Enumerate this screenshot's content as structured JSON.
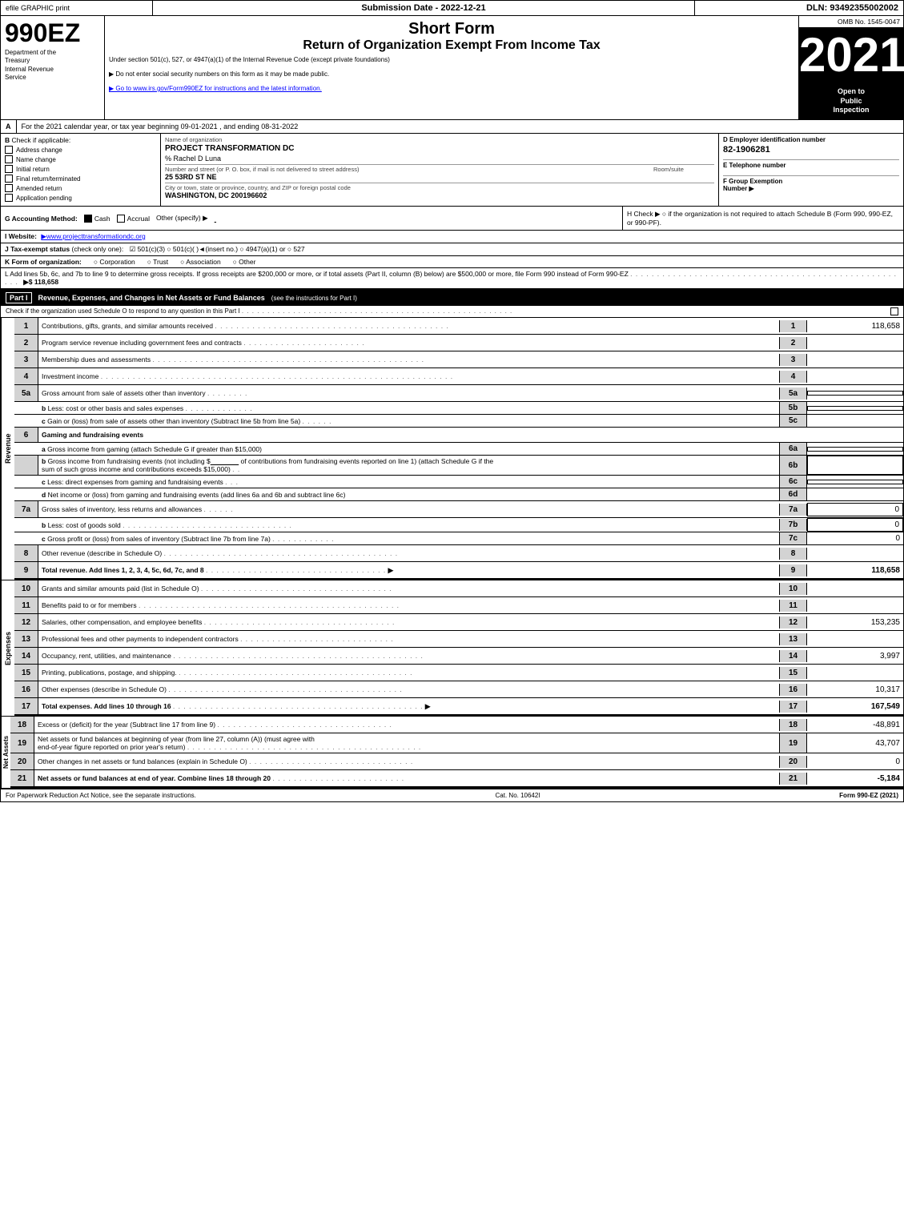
{
  "header": {
    "efile": "efile GRAPHIC print",
    "submission": "Submission Date - 2022-12-21",
    "dln": "DLN: 93492355002002",
    "omb": "OMB No. 1545-0047"
  },
  "form": {
    "number": "990EZ",
    "dept1": "Department of the",
    "dept2": "Treasury",
    "dept3": "Internal Revenue",
    "dept4": "Service",
    "short_form": "Short Form",
    "return_title": "Return of Organization Exempt From Income Tax",
    "under_section": "Under section 501(c), 527, or 4947(a)(1) of the Internal Revenue Code (except private foundations)",
    "do_not_enter": "▶ Do not enter social security numbers on this form as it may be made public.",
    "go_to": "▶ Go to www.irs.gov/Form990EZ for instructions and the latest information.",
    "year": "2021",
    "open_to_public": "Open to\nPublic\nInspection"
  },
  "section_a": {
    "label": "A",
    "text": "For the 2021 calendar year, or tax year beginning 09-01-2021 , and ending 08-31-2022"
  },
  "section_b": {
    "label": "B",
    "sublabel": "Check if applicable:",
    "items": [
      {
        "label": "Address change",
        "checked": false
      },
      {
        "label": "Name change",
        "checked": false
      },
      {
        "label": "Initial return",
        "checked": false
      },
      {
        "label": "Final return/terminated",
        "checked": false
      },
      {
        "label": "Amended return",
        "checked": false
      },
      {
        "label": "Application pending",
        "checked": false
      }
    ]
  },
  "section_c": {
    "label": "C",
    "name_label": "Name of organization",
    "org_name": "PROJECT TRANSFORMATION DC",
    "care_of": "% Rachel D Luna",
    "street_label": "Number and street (or P. O. box, if mail is not delivered to street address)",
    "street": "25 53RD ST NE",
    "room_label": "Room/suite",
    "city_label": "City or town, state or province, country, and ZIP or foreign postal code",
    "city": "WASHINGTON, DC  200196602"
  },
  "section_d": {
    "label": "D",
    "ein_label": "D Employer identification number",
    "ein": "82-1906281",
    "phone_label": "E Telephone number"
  },
  "section_f": {
    "label": "F",
    "group_label": "F Group Exemption\nNumber"
  },
  "section_g": {
    "label": "G",
    "accounting_label": "G Accounting Method:",
    "cash": "Cash",
    "accrual": "Accrual",
    "other": "Other (specify) ▶",
    "cash_checked": true
  },
  "section_h": {
    "label": "H",
    "text": "H  Check ▶  ○ if the organization is not required to attach Schedule B (Form 990, 990-EZ, or 990-PF)."
  },
  "website": {
    "label": "I Website:",
    "url": "▶www.projecttransformationdc.org"
  },
  "tax_exempt": {
    "label": "J Tax-exempt status",
    "note": "(check only one):",
    "options": "☑ 501(c)(3)  ○ 501(c)(  )◄(insert no.)  ○ 4947(a)(1) or  ○ 527"
  },
  "form_k": {
    "label": "K",
    "text": "K Form of organization:",
    "options": [
      "○ Corporation",
      "○ Trust",
      "○ Association",
      "○ Other"
    ]
  },
  "form_l": {
    "label": "L",
    "text": "L Add lines 5b, 6c, and 7b to line 9 to determine gross receipts. If gross receipts are $200,000 or more, or if total assets (Part II, column (B) below) are $500,000 or more, file Form 990 instead of Form 990-EZ",
    "dots": ". . . . . . . . . . . . . . . . . . . . . . . . . . . . . . . . . . . . . . . . . .",
    "arrow": "▶$",
    "value": "118,658"
  },
  "part1": {
    "label": "Part I",
    "title": "Revenue, Expenses, and Changes in Net Assets or Fund Balances",
    "see_instructions": "(see the instructions for Part I)",
    "check_note": "Check if the organization used Schedule O to respond to any question in this Part I",
    "dots_long": ". . . . . . . . . . . . . . . . . . . . . . . . . . . . . . . . . . . . . . . . . . . . . . . .",
    "rows": [
      {
        "num": "1",
        "label": "Contributions, gifts, grants, and similar amounts received",
        "dots": ". . . . . . . . . . . . . . . . . . . . . . . . . . . . . . . . . . . . . . . . . . . .",
        "ref": "1",
        "value": "118,658"
      },
      {
        "num": "2",
        "label": "Program service revenue including government fees and contracts",
        "dots": ". . . . . . . . . . . . . . . . . . . . . . .",
        "ref": "2",
        "value": ""
      },
      {
        "num": "3",
        "label": "Membership dues and assessments",
        "dots": ". . . . . . . . . . . . . . . . . . . . . . . . . . . . . . . . . . . . . . . . . . . . . . . . . . .",
        "ref": "3",
        "value": ""
      },
      {
        "num": "4",
        "label": "Investment income",
        "dots": ". . . . . . . . . . . . . . . . . . . . . . . . . . . . . . . . . . . . . . . . . . . . . . . . . . . . . . . . . . . . . . . . . .",
        "ref": "4",
        "value": ""
      },
      {
        "num": "5a",
        "label": "Gross amount from sale of assets other than inventory",
        "dots": ". . . . . . . .",
        "ref": "5a",
        "value": ""
      },
      {
        "num": "5b",
        "label": "Less: cost or other basis and sales expenses",
        "dots": ". . . . . . . . . . . .",
        "ref": "5b",
        "value": ""
      },
      {
        "num": "5c",
        "label": "Gain or (loss) from sale of assets other than inventory (Subtract line 5b from line 5a)",
        "dots": ". . . . . .",
        "ref": "5c",
        "value": ""
      },
      {
        "num": "6",
        "label": "Gaming and fundraising events",
        "dots": "",
        "ref": "",
        "value": ""
      },
      {
        "num": "6a",
        "label": "Gross income from gaming (attach Schedule G if greater than $15,000)",
        "dots": "",
        "ref": "6a",
        "value": ""
      },
      {
        "num": "6b",
        "label": "Gross income from fundraising events (not including $_____ of contributions from fundraising events reported on line 1) (attach Schedule G if the sum of such gross income and contributions exceeds $15,000)",
        "dots": ". .",
        "ref": "6b",
        "value": ""
      },
      {
        "num": "6c",
        "label": "Less: direct expenses from gaming and fundraising events",
        "dots": ". . .",
        "ref": "6c",
        "value": ""
      },
      {
        "num": "6d",
        "label": "Net income or (loss) from gaming and fundraising events (add lines 6a and 6b and subtract line 6c)",
        "dots": "",
        "ref": "6d",
        "value": ""
      },
      {
        "num": "7a",
        "label": "Gross sales of inventory, less returns and allowances",
        "dots": ". . . . . .",
        "ref": "7a",
        "value": "0"
      },
      {
        "num": "7b",
        "label": "Less: cost of goods sold",
        "dots": ". . . . . . . . . . . . . . . . . . . . . . . . . . . . . . . .",
        "ref": "7b",
        "value": "0"
      },
      {
        "num": "7c",
        "label": "Gross profit or (loss) from sales of inventory (Subtract line 7b from line 7a)",
        "dots": ". . . . . . . . . . . .",
        "ref": "7c",
        "value": "0"
      },
      {
        "num": "8",
        "label": "Other revenue (describe in Schedule O)",
        "dots": ". . . . . . . . . . . . . . . . . . . . . . . . . . . . . . . . . . . . . . . . . . . .",
        "ref": "8",
        "value": ""
      },
      {
        "num": "9",
        "label": "Total revenue. Add lines 1, 2, 3, 4, 5c, 6d, 7c, and 8",
        "dots": ". . . . . . . . . . . . . . . . . . . . . . . . . . . . . . . . . .",
        "arrow": "▶",
        "ref": "9",
        "value": "118,658",
        "bold": true
      }
    ]
  },
  "expenses": {
    "rows": [
      {
        "num": "10",
        "label": "Grants and similar amounts paid (list in Schedule O)",
        "dots": ". . . . . . . . . . . . . . . . . . . . . . . . . . . . . . . . . . . .",
        "ref": "10",
        "value": ""
      },
      {
        "num": "11",
        "label": "Benefits paid to or for members",
        "dots": ". . . . . . . . . . . . . . . . . . . . . . . . . . . . . . . . . . . . . . . . . . . . . . . . .",
        "ref": "11",
        "value": ""
      },
      {
        "num": "12",
        "label": "Salaries, other compensation, and employee benefits",
        "dots": ". . . . . . . . . . . . . . . . . . . . . . . . . . . . . . . . . . . .",
        "ref": "12",
        "value": "153,235"
      },
      {
        "num": "13",
        "label": "Professional fees and other payments to independent contractors",
        "dots": ". . . . . . . . . . . . . . . . . . . . . . . . . . . . .",
        "ref": "13",
        "value": ""
      },
      {
        "num": "14",
        "label": "Occupancy, rent, utilities, and maintenance",
        "dots": ". . . . . . . . . . . . . . . . . . . . . . . . . . . . . . . . . . . . . . . . . . . . . . . .",
        "ref": "14",
        "value": "3,997"
      },
      {
        "num": "15",
        "label": "Printing, publications, postage, and shipping.",
        "dots": ". . . . . . . . . . . . . . . . . . . . . . . . . . . . . . . . . . . . . . . . . . . . .",
        "ref": "15",
        "value": ""
      },
      {
        "num": "16",
        "label": "Other expenses (describe in Schedule O)",
        "dots": ". . . . . . . . . . . . . . . . . . . . . . . . . . . . . . . . . . . . . . . . . . . .",
        "ref": "16",
        "value": "10,317"
      },
      {
        "num": "17",
        "label": "Total expenses. Add lines 10 through 16",
        "dots": ". . . . . . . . . . . . . . . . . . . . . . . . . . . . . . . . . . . . . . . . . . . . . . . .",
        "arrow": "▶",
        "ref": "17",
        "value": "167,549",
        "bold": true
      }
    ]
  },
  "net_assets": {
    "rows": [
      {
        "num": "18",
        "label": "Excess or (deficit) for the year (Subtract line 17 from line 9)",
        "dots": ". . . . . . . . . . . . . . . . . . . . . . . . . . . . . . . . .",
        "ref": "18",
        "value": "-48,891"
      },
      {
        "num": "19",
        "label": "Net assets or fund balances at beginning of year (from line 27, column (A)) (must agree with end-of-year figure reported on prior year's return)",
        "dots": ". . . . . . . . . . . . . . . . . . . . . . . . . . . . . . . . . . . . . . . . . . . .",
        "ref": "19",
        "value": "43,707"
      },
      {
        "num": "20",
        "label": "Other changes in net assets or fund balances (explain in Schedule O)",
        "dots": ". . . . . . . . . . . . . . . . . . . . . . . . . . . . . . .",
        "ref": "20",
        "value": "0"
      },
      {
        "num": "21",
        "label": "Net assets or fund balances at end of year. Combine lines 18 through 20",
        "dots": ". . . . . . . . . . . . . . . . . . . . . . . .",
        "ref": "21",
        "value": "-5,184"
      }
    ]
  },
  "footer": {
    "paperwork": "For Paperwork Reduction Act Notice, see the separate instructions.",
    "cat_no": "Cat. No. 10642I",
    "form_ref": "Form 990-EZ (2021)"
  }
}
